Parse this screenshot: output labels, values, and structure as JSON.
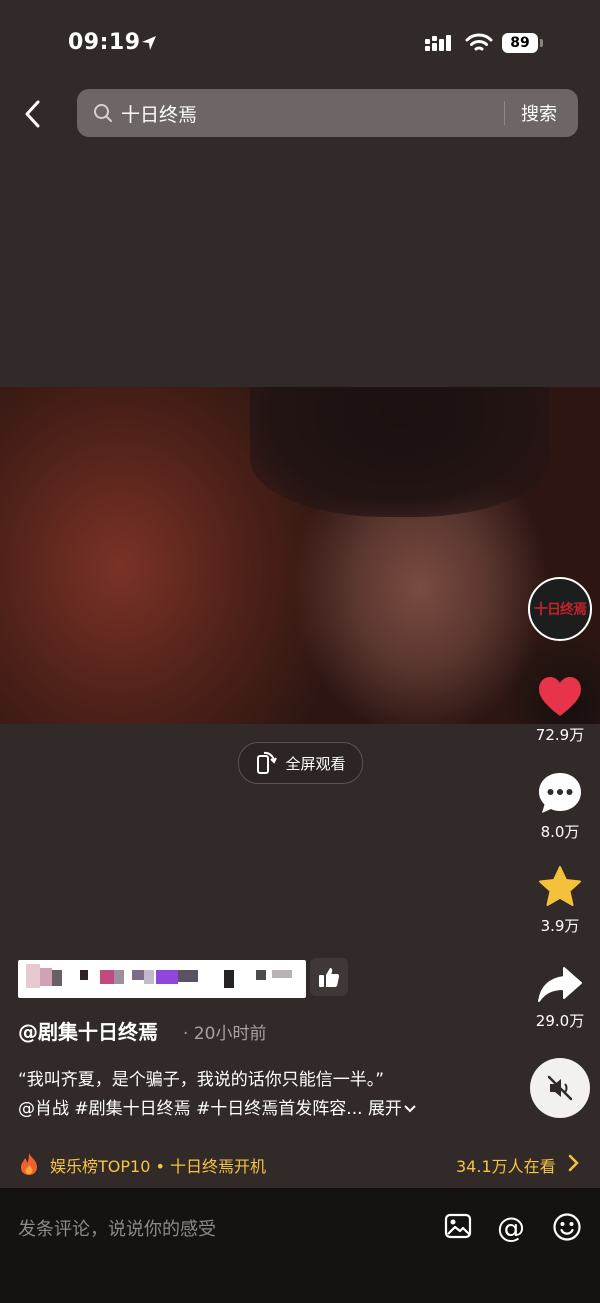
{
  "status_bar": {
    "time": "09:19",
    "battery": "89"
  },
  "header": {
    "search_query": "十日终焉",
    "search_button": "搜索"
  },
  "player": {
    "fullscreen_label": "全屏观看"
  },
  "rail": {
    "avatar_logo": "十日终焉",
    "likes": "72.9万",
    "comments": "8.0万",
    "favorites": "3.9万",
    "shares": "29.0万"
  },
  "post": {
    "author": "@剧集十日终焉",
    "time": "· 20小时前",
    "quote": "“我叫齐夏，是个骗子，我说的话你只能信一半。”",
    "mention": "@肖战",
    "tag1": "#剧集十日终焉",
    "tag2": "#十日终焉首发阵容...",
    "expand": "展开"
  },
  "ranking": {
    "label": "娱乐榜TOP10 • 十日终焉开机",
    "watching": "34.1万人在看"
  },
  "comment_bar": {
    "placeholder": "发条评论，说说你的感受",
    "at": "@"
  },
  "colors": {
    "background": "#322a29",
    "accent_like": "#e8344a",
    "accent_star": "#f5c13b",
    "rank_gold": "#f5c344"
  }
}
